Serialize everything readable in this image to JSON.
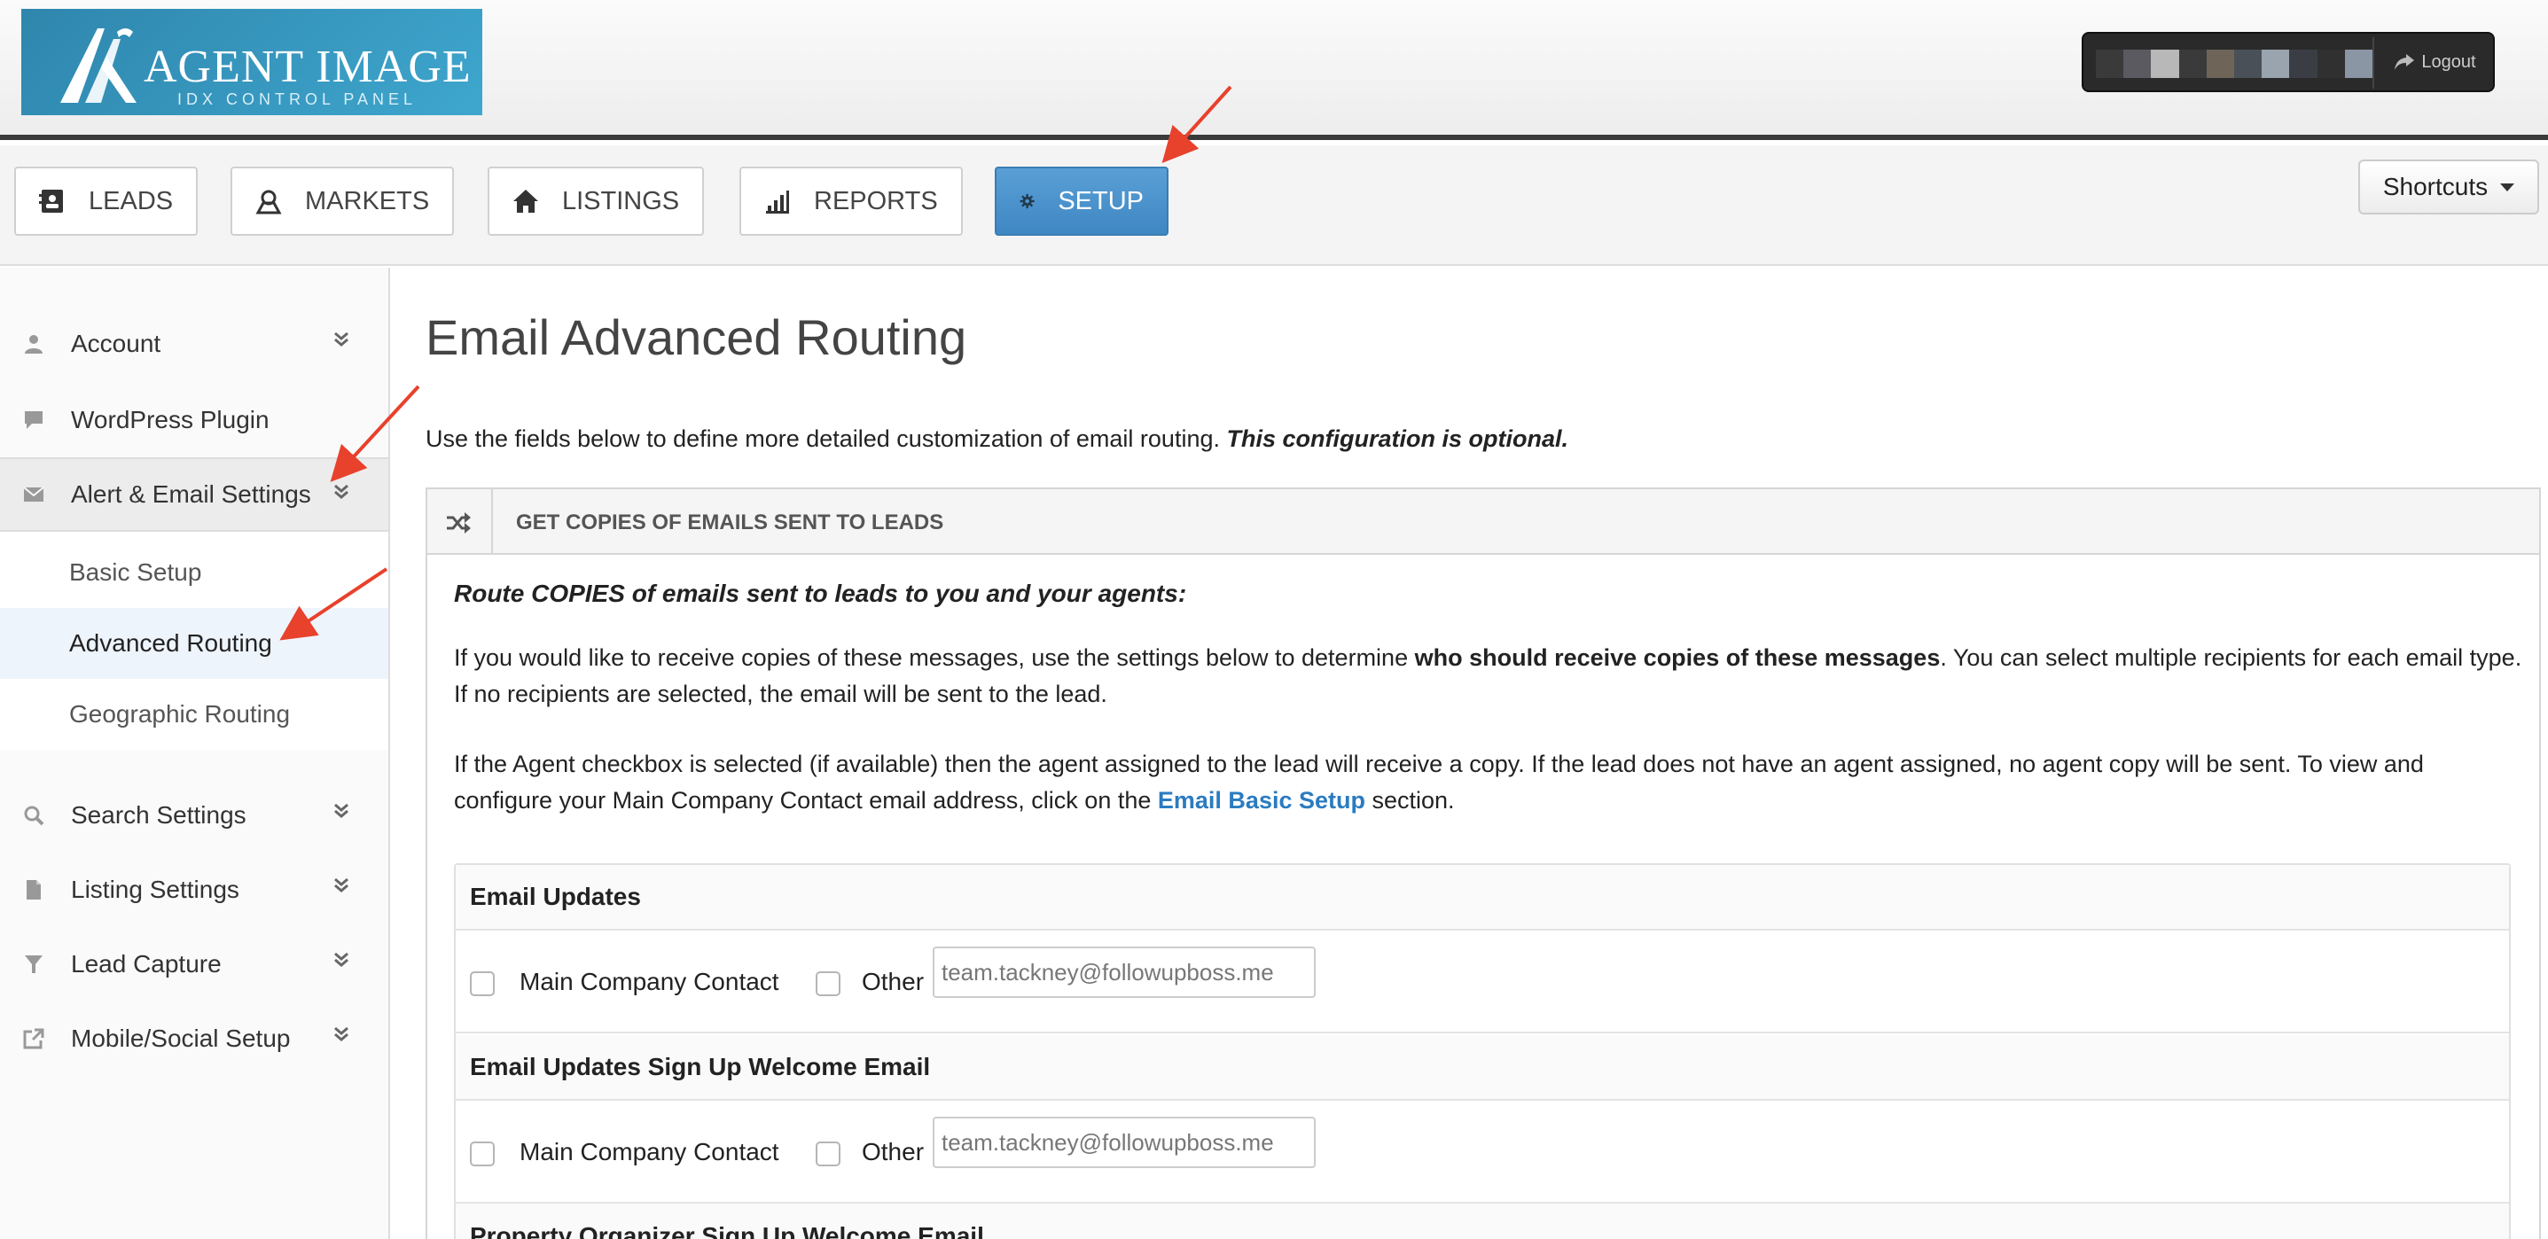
{
  "header": {
    "logo_title": "AGENT IMAGE",
    "logo_subtitle": "IDX CONTROL PANEL",
    "logout_label": "Logout",
    "blurred_user_colors": [
      "#3a3a3a",
      "#5a5a60",
      "#b8b8b8",
      "#3a3a3a",
      "#6e6458",
      "#4a5058",
      "#9aa4ae",
      "#3a3e44",
      "#303030",
      "#8a96a4"
    ]
  },
  "nav": {
    "tabs": [
      {
        "label": "LEADS",
        "icon": "contact-card-icon"
      },
      {
        "label": "MARKETS",
        "icon": "map-pin-icon"
      },
      {
        "label": "LISTINGS",
        "icon": "home-icon"
      },
      {
        "label": "REPORTS",
        "icon": "bar-chart-icon"
      },
      {
        "label": "SETUP",
        "icon": "gear-icon",
        "active": true
      }
    ],
    "shortcuts_label": "Shortcuts"
  },
  "sidebar": {
    "items": [
      {
        "label": "Account"
      },
      {
        "label": "WordPress Plugin"
      },
      {
        "label": "Alert & Email Settings"
      },
      {
        "label": "Search Settings"
      },
      {
        "label": "Listing Settings"
      },
      {
        "label": "Lead Capture"
      },
      {
        "label": "Mobile/Social Setup"
      }
    ],
    "sub_items": [
      {
        "label": "Basic Setup"
      },
      {
        "label": "Advanced Routing"
      },
      {
        "label": "Geographic Routing"
      }
    ]
  },
  "main": {
    "title": "Email Advanced Routing",
    "intro": "Use the fields below to define more detailed customization of email routing.",
    "intro_emphasis": "This configuration is optional.",
    "panel": {
      "title": "GET COPIES OF EMAILS SENT TO LEADS",
      "lead": "Route COPIES of emails sent to leads to you and your agents:",
      "para1_a": "If you would like to receive copies of these messages, use the settings below to determine",
      "para1_bold": "who should receive copies of these messages",
      "para1_b": ". You can select multiple recipients for each email type. If no recipients are selected, the email will be sent to the lead.",
      "para2_a": "If the Agent checkbox is selected (if available) then the agent assigned to the lead will receive a copy. If the lead does not have an agent assigned, no agent copy will be sent. To view and configure your Main Company Contact email address, click on the",
      "para2_link": "Email Basic Setup",
      "para2_b": "section.",
      "sections": [
        {
          "title": "Email Updates",
          "main_label": "Main Company Contact",
          "other_label": "Other",
          "other_value": "team.tackney@followupboss.me"
        },
        {
          "title": "Email Updates Sign Up Welcome Email",
          "main_label": "Main Company Contact",
          "other_label": "Other",
          "other_value": "team.tackney@followupboss.me"
        },
        {
          "title": "Property Organizer Sign Up Welcome Email"
        }
      ]
    }
  },
  "colors": {
    "accent": "#3f87c4",
    "link": "#2b7bc0",
    "annotation_arrow": "#e8412c"
  }
}
